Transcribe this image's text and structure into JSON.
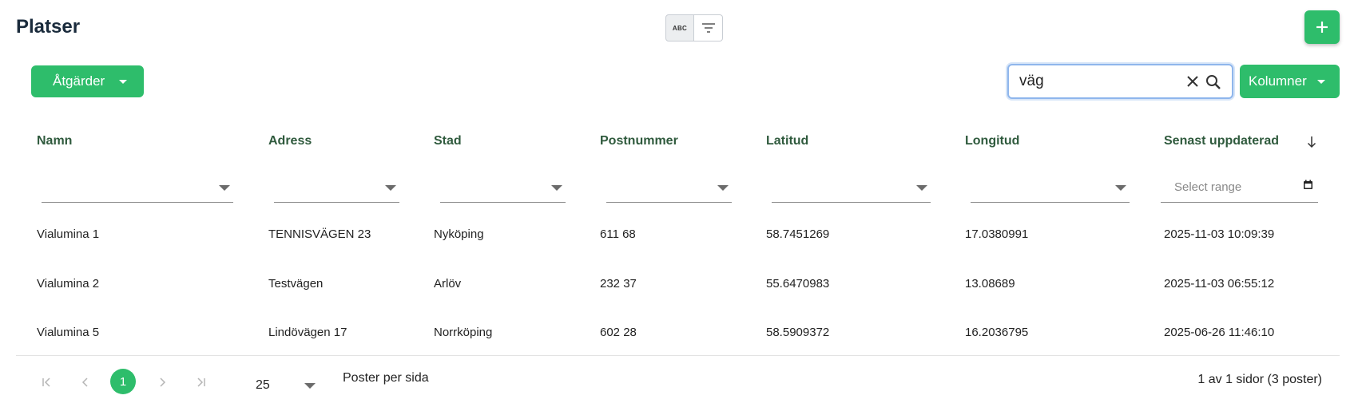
{
  "header": {
    "title": "Platser"
  },
  "toolbar": {
    "abc_label": "ABC"
  },
  "actions": {
    "label": "Åtgärder"
  },
  "search": {
    "value": "väg"
  },
  "columns_button": {
    "label": "Kolumner"
  },
  "table": {
    "columns": [
      "Namn",
      "Adress",
      "Stad",
      "Postnummer",
      "Latitud",
      "Longitud",
      "Senast uppdaterad"
    ],
    "date_filter_placeholder": "Select range",
    "rows": [
      [
        "Vialumina 1",
        "TENNISVÄGEN 23",
        "Nyköping",
        "611 68",
        "58.7451269",
        "17.0380991",
        "2025-11-03 10:09:39"
      ],
      [
        "Vialumina 2",
        "Testvägen",
        "Arlöv",
        "232 37",
        "55.6470983",
        "13.08689",
        "2025-11-03 06:55:12"
      ],
      [
        "Vialumina 5",
        "Lindövägen 17",
        "Norrköping",
        "602 28",
        "58.5909372",
        "16.2036795",
        "2025-06-26 11:46:10"
      ]
    ]
  },
  "pagination": {
    "current_page": "1",
    "page_size": "25",
    "per_page_label": "Poster per sida",
    "info": "1 av 1 sidor (3 poster)"
  },
  "colors": {
    "accent": "#2ebd6b",
    "header_text": "#2f5a3d",
    "title": "#1a2b3c"
  },
  "icons": [
    "abc-icon",
    "filter-icon",
    "plus-icon",
    "caret-down-icon",
    "close-icon",
    "search-icon",
    "arrow-down-icon",
    "calendar-icon",
    "first-page-icon",
    "prev-page-icon",
    "next-page-icon",
    "last-page-icon"
  ]
}
